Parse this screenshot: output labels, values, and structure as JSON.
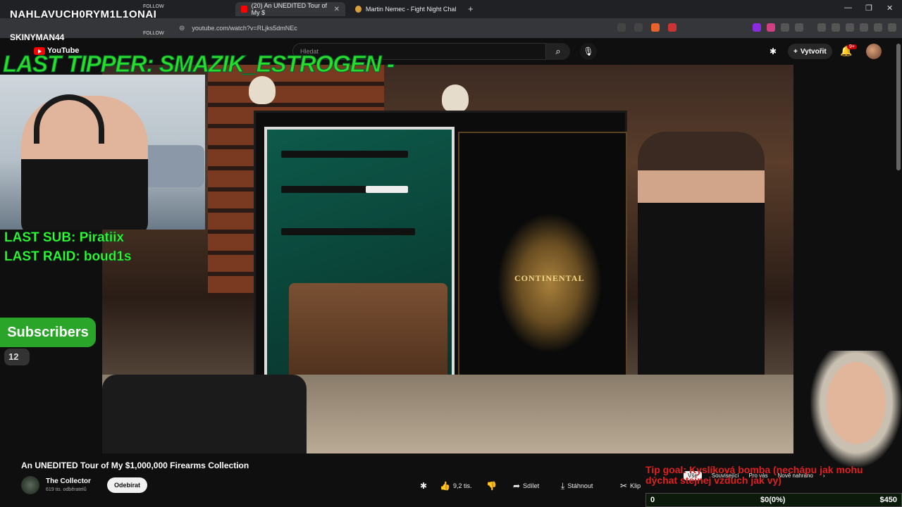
{
  "browser": {
    "tabs": [
      {
        "title": "(20) An UNEDITED Tour of My $",
        "active": true
      },
      {
        "title": "Martin Nemec - Fight Night Challeng",
        "active": false
      }
    ],
    "new_tab": "+",
    "url": "youtube.com/watch?v=RLjks5dmNEc",
    "controls": {
      "minimize": "—",
      "maximize": "❐",
      "close": "✕"
    }
  },
  "youtube": {
    "logo": "YouTube",
    "search_placeholder": "Hledat",
    "create_label": "Vytvořit",
    "notif_badge": "9+",
    "video": {
      "crest_text": "CONTINENTAL"
    },
    "title": "An UNEDITED Tour of My $1,000,000 Firearms Collection",
    "channel": {
      "name": "The Collector",
      "subs": "619 tis. odběratelů"
    },
    "subscribe_label": "Odebírat",
    "actions": {
      "like_count": "9,2 tis.",
      "share": "Sdílet",
      "download": "Stáhnout",
      "clip": "Klip"
    },
    "chips": [
      "Vše",
      "Související",
      "Pro vás",
      "Nově nahráno"
    ]
  },
  "stream_overlay": {
    "follower1": "NAHLAVUCH0RYM1L1ONAI",
    "follower2": "SKINYMAN44",
    "follow_label": "FOLLOW",
    "last_tipper": "LAST TIPPER: SMAZIK_ESTROGEN -",
    "last_sub": "LAST SUB: Piratiix",
    "last_raid": "LAST RAID: boud1s",
    "subscribers_label": "Subscribers",
    "subscribers_count": "12",
    "tip_goal": "Tip goal: Kyslíková bomba (nechápu jak mohu dýchat stejnej vzduch jak vy)",
    "tip_progress": {
      "start": "0",
      "current": "$0(0%)",
      "goal": "$450",
      "fraction": 0.0
    }
  },
  "colors": {
    "overlay_green": "#2bdc2b",
    "tip_red": "#e02020",
    "yt_red": "#ff0000"
  }
}
